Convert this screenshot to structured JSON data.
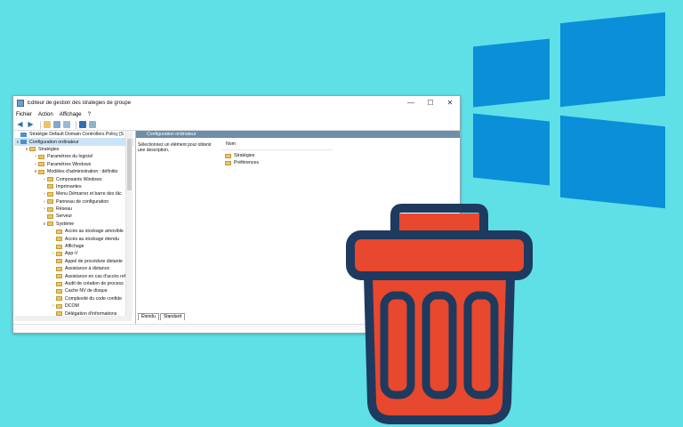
{
  "window": {
    "title": "Éditeur de gestion des stratégies de groupe",
    "controls": {
      "minimize": "—",
      "maximize": "☐",
      "close": "✕"
    }
  },
  "menu": [
    "Fichier",
    "Action",
    "Affichage",
    "?"
  ],
  "tree": [
    {
      "label": "Stratégie Default Domain Controllers Policy [S",
      "level": 0,
      "twisty": "",
      "icon": "policy"
    },
    {
      "label": "Configuration ordinateur",
      "level": 0,
      "twisty": "∨",
      "icon": "pc",
      "selected": true
    },
    {
      "label": "Stratégies",
      "level": 1,
      "twisty": "∨",
      "icon": "folder"
    },
    {
      "label": "Paramètres du logiciel",
      "level": 2,
      "twisty": "›",
      "icon": "folder"
    },
    {
      "label": "Paramètres Windows",
      "level": 2,
      "twisty": "›",
      "icon": "folder"
    },
    {
      "label": "Modèles d'administration : définitio",
      "level": 2,
      "twisty": "∨",
      "icon": "folder"
    },
    {
      "label": "Composants Windows",
      "level": 3,
      "twisty": "›",
      "icon": "folder"
    },
    {
      "label": "Imprimantes",
      "level": 3,
      "twisty": "",
      "icon": "folder"
    },
    {
      "label": "Menu Démarrer et barre des tâc",
      "level": 3,
      "twisty": "›",
      "icon": "folder"
    },
    {
      "label": "Panneau de configuration",
      "level": 3,
      "twisty": "›",
      "icon": "folder"
    },
    {
      "label": "Réseau",
      "level": 3,
      "twisty": "›",
      "icon": "folder"
    },
    {
      "label": "Serveur",
      "level": 3,
      "twisty": "",
      "icon": "folder"
    },
    {
      "label": "Système",
      "level": 3,
      "twisty": "∨",
      "icon": "folder"
    },
    {
      "label": "Accès au stockage amovible",
      "level": 4,
      "twisty": "",
      "icon": "folder"
    },
    {
      "label": "Accès au stockage étendu",
      "level": 4,
      "twisty": "",
      "icon": "folder"
    },
    {
      "label": "Affichage",
      "level": 4,
      "twisty": "",
      "icon": "folder"
    },
    {
      "label": "App-V",
      "level": 4,
      "twisty": "›",
      "icon": "folder"
    },
    {
      "label": "Appel de procédure distante",
      "level": 4,
      "twisty": "",
      "icon": "folder"
    },
    {
      "label": "Assistance à distance",
      "level": 4,
      "twisty": "",
      "icon": "folder"
    },
    {
      "label": "Assistance en cas d'accès ref",
      "level": 4,
      "twisty": "",
      "icon": "folder"
    },
    {
      "label": "Audit de création de process",
      "level": 4,
      "twisty": "",
      "icon": "folder"
    },
    {
      "label": "Cache NV de disque",
      "level": 4,
      "twisty": "",
      "icon": "folder"
    },
    {
      "label": "Complexité du code confide",
      "level": 4,
      "twisty": "",
      "icon": "folder"
    },
    {
      "label": "DCOM",
      "level": 4,
      "twisty": "›",
      "icon": "folder"
    },
    {
      "label": "Délégation d'informations",
      "level": 4,
      "twisty": "",
      "icon": "folder"
    }
  ],
  "right": {
    "header": "Configuration ordinateur",
    "description": "Sélectionnez un élément pour obtenir une description.",
    "column": "Nom",
    "items": [
      "Stratégies",
      "Préférences"
    ]
  },
  "tabs": [
    "Étendu",
    "Standard"
  ],
  "colors": {
    "windows_blue": "#0a8fd8",
    "trash_red": "#e8482e",
    "trash_navy": "#1f3a5f",
    "background": "#5ee0e6"
  }
}
